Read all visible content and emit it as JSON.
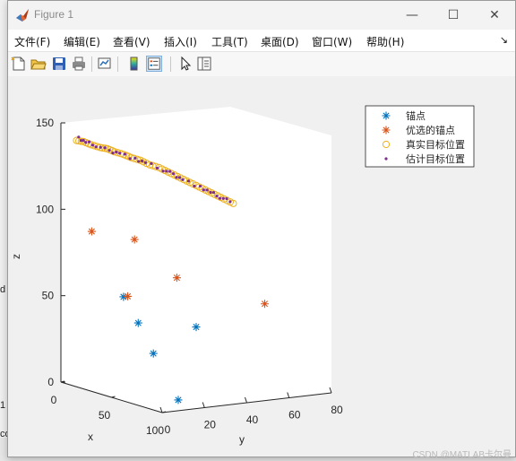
{
  "window": {
    "title": "Figure 1",
    "controls": {
      "minimize": "—",
      "maximize": "☐",
      "close": "✕"
    }
  },
  "menu": {
    "items": [
      "文件(F)",
      "编辑(E)",
      "查看(V)",
      "插入(I)",
      "工具(T)",
      "桌面(D)",
      "窗口(W)",
      "帮助(H)"
    ],
    "overflow": "↘"
  },
  "toolbar": {
    "buttons": [
      "new-figure-icon",
      "open-file-icon",
      "save-icon",
      "print-icon",
      "link-plot-icon",
      "colorbar-icon",
      "legend-icon",
      "edit-plot-arrow-icon",
      "property-inspector-icon"
    ],
    "active": "legend-icon"
  },
  "background_window": {
    "fragments": [
      "d",
      "1",
      "co"
    ]
  },
  "watermark": "CSDN @MATLAB卡尔曼",
  "chart_data": {
    "type": "scatter",
    "projection": "3d",
    "xlabel": "x",
    "ylabel": "y",
    "zlabel": "z",
    "x_ticks": [
      "0",
      "50",
      "100"
    ],
    "y_ticks": [
      "0",
      "20",
      "40",
      "60",
      "80"
    ],
    "z_ticks": [
      "0",
      "50",
      "100",
      "150"
    ],
    "xlim": [
      0,
      100
    ],
    "ylim": [
      0,
      80
    ],
    "zlim": [
      0,
      150
    ],
    "grid": false,
    "legend_position": "top-right",
    "colors": {
      "anchor": "#0072bd",
      "optimal_anchor": "#d95319",
      "true_position": "#edb120",
      "estimated_position": "#7e2f8e"
    },
    "series": [
      {
        "name": "锚点",
        "marker": "*",
        "points": [
          [
            60,
            15,
            25
          ],
          [
            20,
            20,
            50
          ],
          [
            45,
            15,
            40
          ],
          [
            50,
            40,
            35
          ],
          [
            95,
            10,
            5
          ]
        ]
      },
      {
        "name": "优选的锚点",
        "marker": "*",
        "points": [
          [
            20,
            5,
            90
          ],
          [
            10,
            30,
            80
          ],
          [
            20,
            22,
            50
          ],
          [
            10,
            50,
            55
          ],
          [
            55,
            70,
            45
          ]
        ]
      },
      {
        "name": "真实目标位置",
        "marker": "o",
        "points": [
          [
            5,
            5,
            140
          ],
          [
            10,
            6,
            140
          ],
          [
            15,
            7,
            139
          ],
          [
            20,
            9,
            138
          ],
          [
            25,
            10,
            138
          ],
          [
            30,
            11,
            137
          ],
          [
            35,
            13,
            136
          ],
          [
            40,
            14,
            135
          ],
          [
            45,
            16,
            134
          ],
          [
            50,
            18,
            132
          ],
          [
            55,
            20,
            131
          ],
          [
            60,
            22,
            129
          ],
          [
            65,
            24,
            127
          ],
          [
            70,
            26,
            125
          ],
          [
            75,
            28,
            123
          ],
          [
            80,
            30,
            121
          ],
          [
            85,
            32,
            119
          ],
          [
            90,
            34,
            117
          ],
          [
            95,
            36,
            115
          ]
        ]
      },
      {
        "name": "估计目标位置",
        "marker": ".",
        "points": [
          [
            5,
            6,
            141
          ],
          [
            12,
            6,
            140
          ],
          [
            18,
            8,
            139
          ],
          [
            27,
            10,
            137
          ],
          [
            33,
            12,
            137
          ],
          [
            42,
            15,
            134
          ],
          [
            48,
            17,
            133
          ],
          [
            57,
            21,
            130
          ],
          [
            63,
            23,
            128
          ],
          [
            68,
            25,
            126
          ],
          [
            77,
            29,
            122
          ],
          [
            83,
            31,
            120
          ],
          [
            88,
            33,
            118
          ],
          [
            94,
            35,
            116
          ]
        ]
      }
    ]
  }
}
